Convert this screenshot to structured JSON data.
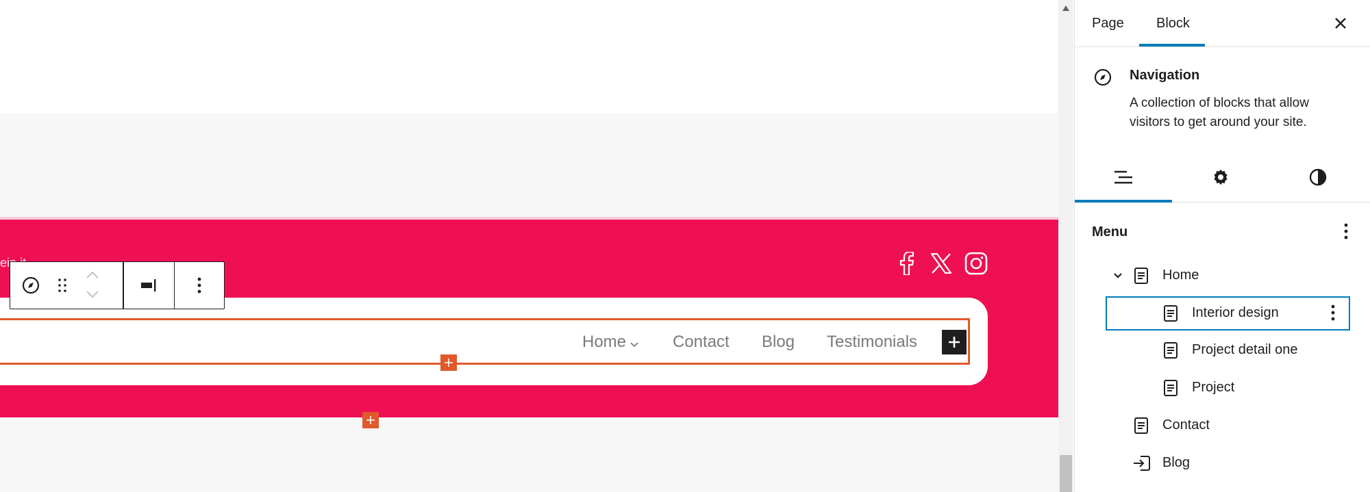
{
  "canvas": {
    "partial_text": "ein it",
    "nav_items": [
      "Home",
      "Contact",
      "Blog",
      "Testimonials"
    ],
    "social_icons": [
      "facebook-icon",
      "x-twitter-icon",
      "instagram-icon"
    ],
    "colors": {
      "band": "#ef0f53",
      "accent": "#e0592a",
      "nav_text": "#7a7a7a"
    }
  },
  "toolbar": {
    "icons": [
      "navigation-compass-icon",
      "drag-handle-icon",
      "move-up-icon",
      "move-down-icon",
      "justify-right-icon",
      "more-options-icon"
    ]
  },
  "sidebar": {
    "tabs": {
      "page": "Page",
      "block": "Block",
      "active": "Block"
    },
    "block": {
      "title": "Navigation",
      "description": "A collection of blocks that allow visitors to get around your site."
    },
    "sub_tabs": [
      "list-view-icon",
      "settings-gear-icon",
      "styles-contrast-icon"
    ],
    "menu": {
      "heading": "Menu",
      "items": [
        {
          "label": "Home",
          "level": 0,
          "expanded": true,
          "icon": "page-icon"
        },
        {
          "label": "Interior design",
          "level": 1,
          "selected": true,
          "icon": "page-icon"
        },
        {
          "label": "Project detail one",
          "level": 1,
          "icon": "page-icon"
        },
        {
          "label": "Project",
          "level": 1,
          "icon": "page-icon"
        },
        {
          "label": "Contact",
          "level": 0,
          "icon": "page-icon"
        },
        {
          "label": "Blog",
          "level": 0,
          "icon": "login-icon"
        }
      ]
    },
    "colors": {
      "accent": "#007cba"
    }
  }
}
